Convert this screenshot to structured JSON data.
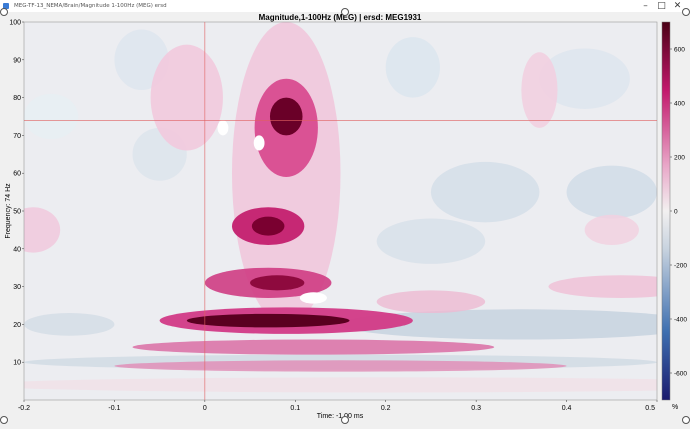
{
  "window": {
    "title": "MEG-TF-13_NEMA/Brain/Magnitude 1-100Hz (MEG) ersd"
  },
  "chart_data": {
    "type": "heatmap",
    "title": "Magnitude,1-100Hz (MEG) | ersd: MEG1931",
    "xlabel": "Time: -1.00 ms",
    "ylabel": "Frequency: 74 Hz",
    "xlim": [
      -0.2,
      0.5
    ],
    "ylim": [
      0,
      100
    ],
    "x_ticks": [
      "-0.2",
      "-0.1",
      "0",
      "0.1",
      "0.2",
      "0.3",
      "0.4",
      "0.5"
    ],
    "y_ticks": [
      "100",
      "90",
      "80",
      "70",
      "60",
      "50",
      "40",
      "30",
      "20",
      "10"
    ],
    "colorbar": {
      "range": [
        -700,
        700
      ],
      "ticks": [
        "600",
        "400",
        "200",
        "0",
        "-200",
        "-400",
        "-600"
      ],
      "unit": "%",
      "colors": [
        "#1a1a6e",
        "#3e6fb0",
        "#c8d3df",
        "#f2f0f0",
        "#e9a7c8",
        "#c2186c",
        "#4a0015"
      ]
    },
    "cursor": {
      "time": 0.0,
      "frequency": 74
    },
    "features": [
      {
        "label": "high-gamma blob",
        "time": 0.09,
        "freq": 74,
        "value": 700
      },
      {
        "label": "gamma blob",
        "time": 0.07,
        "freq": 46,
        "value": 520
      },
      {
        "label": "beta blob",
        "time": 0.07,
        "freq": 31,
        "value": 460
      },
      {
        "label": "low-beta band",
        "time": 0.08,
        "freq": 21,
        "value": 650
      },
      {
        "label": "low-frequency band",
        "time": 0.12,
        "freq": 14,
        "value": 300
      },
      {
        "label": "low-frequency band 2",
        "time": 0.15,
        "freq": 9,
        "value": 250
      }
    ]
  }
}
